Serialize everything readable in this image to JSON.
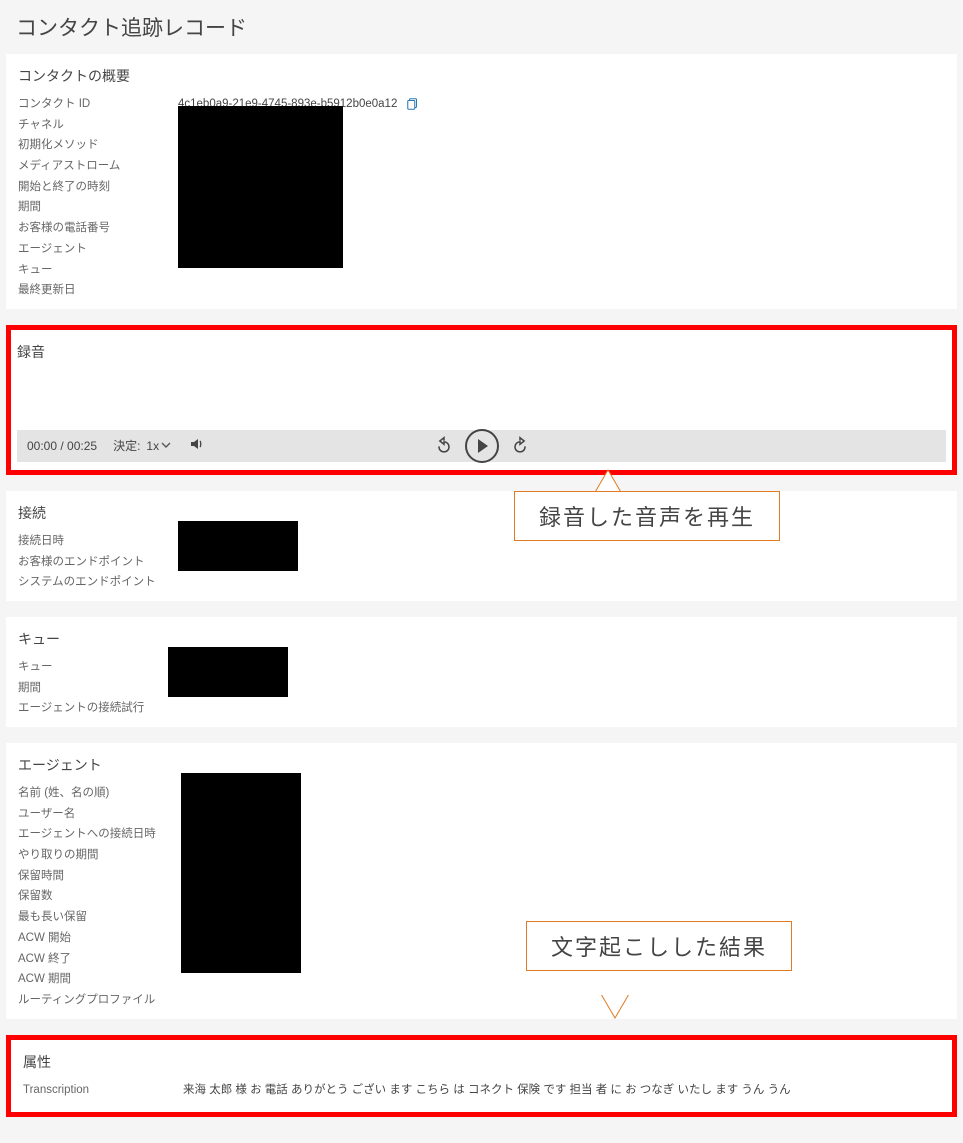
{
  "page": {
    "title": "コンタクト追跡レコード"
  },
  "overview": {
    "title": "コンタクトの概要",
    "fields": {
      "contactId": {
        "label": "コンタクト ID",
        "value": "4c1eb0a9-21e9-4745-893e-b5912b0e0a12"
      },
      "channel": {
        "label": "チャネル"
      },
      "initMethod": {
        "label": "初期化メソッド"
      },
      "mediaStream": {
        "label": "メディアストローム"
      },
      "startEnd": {
        "label": "開始と終了の時刻"
      },
      "duration": {
        "label": "期間"
      },
      "customerPhone": {
        "label": "お客様の電話番号"
      },
      "agent": {
        "label": "エージェント"
      },
      "queue": {
        "label": "キュー"
      },
      "lastModified": {
        "label": "最終更新日"
      }
    }
  },
  "recording": {
    "title": "録音",
    "time": "00:00 / 00:25",
    "speedLabel": "決定:",
    "speedValue": "1x"
  },
  "callouts": {
    "playback": "録音した音声を再生",
    "transcription": "文字起こしした結果"
  },
  "connection": {
    "title": "接続",
    "fields": {
      "connectedAt": {
        "label": "接続日時"
      },
      "customerEndpoint": {
        "label": "お客様のエンドポイント"
      },
      "systemEndpoint": {
        "label": "システムのエンドポイント"
      }
    }
  },
  "queue": {
    "title": "キュー",
    "fields": {
      "queue": {
        "label": "キュー"
      },
      "duration": {
        "label": "期間"
      },
      "agentConnectAttempts": {
        "label": "エージェントの接続試行"
      }
    }
  },
  "agent": {
    "title": "エージェント",
    "fields": {
      "name": {
        "label": "名前 (姓、名の順)"
      },
      "username": {
        "label": "ユーザー名"
      },
      "agentConnectedAt": {
        "label": "エージェントへの接続日時"
      },
      "interaction": {
        "label": "やり取りの期間"
      },
      "holdTime": {
        "label": "保留時間"
      },
      "holds": {
        "label": "保留数"
      },
      "longestHold": {
        "label": "最も長い保留"
      },
      "acwStart": {
        "label": "ACW 開始"
      },
      "acwEnd": {
        "label": "ACW 終了"
      },
      "acwDuration": {
        "label": "ACW 期間"
      },
      "routingProfile": {
        "label": "ルーティングプロファイル"
      }
    }
  },
  "attributes": {
    "title": "属性",
    "transcriptionLabel": "Transcription",
    "transcriptionValue": "来海 太郎 様 お 電話 ありがとう ござい ます こちら は コネクト 保険 です 担当 者 に お つなぎ いたし ます うん うん"
  }
}
